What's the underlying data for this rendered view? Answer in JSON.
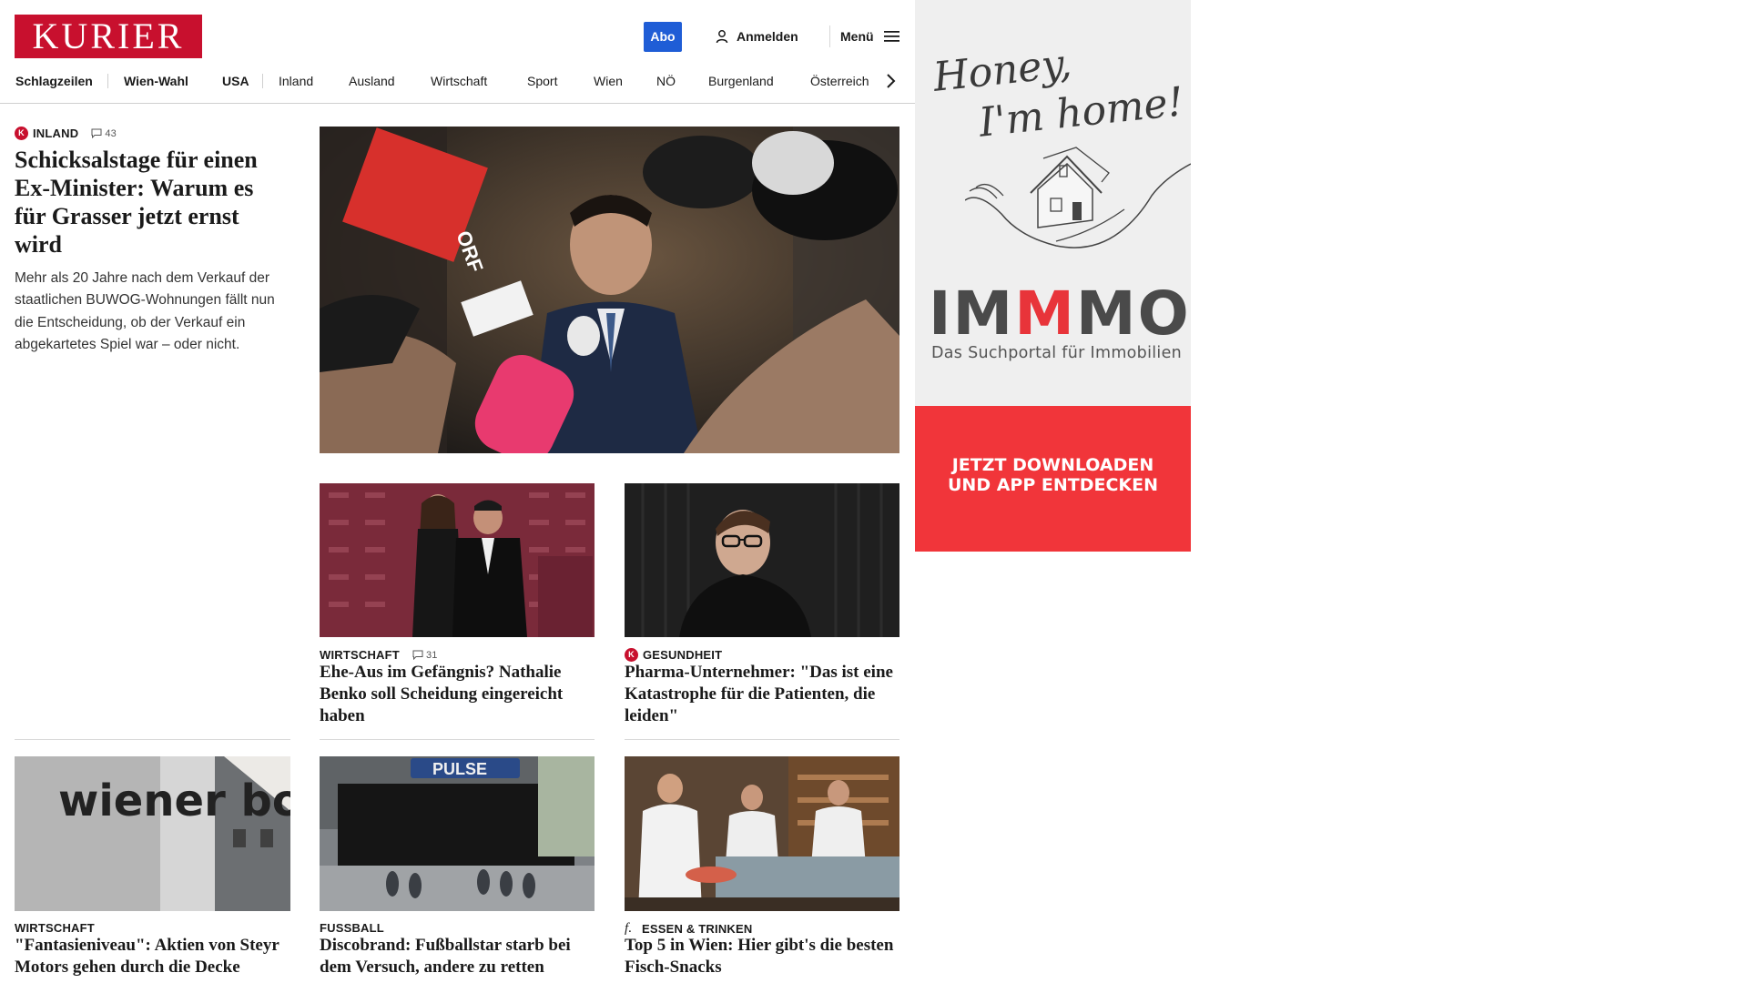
{
  "header": {
    "logo": "KURIER",
    "abo_label": "Abo",
    "login_label": "Anmelden",
    "menu_label": "Menü"
  },
  "nav": {
    "items": [
      "Schlagzeilen",
      "Wien-Wahl",
      "USA",
      "Inland",
      "Ausland",
      "Wirtschaft",
      "Sport",
      "Wien",
      "NÖ",
      "Burgenland",
      "Österreich"
    ]
  },
  "lead": {
    "category": "INLAND",
    "comments": "43",
    "headline": "Schicksalstage für einen Ex-Minister: Warum es für Grasser jetzt ernst wird",
    "teaser": "Mehr als 20 Jahre nach dem Verkauf der staatlichen BUWOG-Wohnungen fällt nun die Entscheidung, ob der Verkauf ein abgekartetes Spiel war – oder nicht."
  },
  "cards": [
    {
      "category": "WIRTSCHAFT",
      "comments": "31",
      "headline": "Ehe-Aus im Gefängnis? Nathalie Benko soll Scheidung eingereicht haben"
    },
    {
      "category": "GESUNDHEIT",
      "headline": "Pharma-Unternehmer: \"Das ist eine Katastrophe für die Patienten, die leiden\""
    },
    {
      "category": "WIRTSCHAFT",
      "headline": "\"Fantasieniveau\": Aktien von Steyr Motors gehen durch die Decke"
    },
    {
      "category": "FUSSBALL",
      "headline": "Discobrand: Fußballstar starb bei dem Versuch, andere zu retten"
    },
    {
      "category": "ESSEN & TRINKEN",
      "headline": "Top 5 in Wien: Hier gibt's die besten Fisch-Snacks"
    }
  ],
  "images": {
    "wiener_boerse_text": "wiener boerse",
    "pulse_sign": "PULSE",
    "orf_mic": "ORF"
  },
  "ad": {
    "tagline_1": "Honey,",
    "tagline_2": "I'm home!",
    "brand_1": "IM",
    "brand_red": "M",
    "brand_2": "MO",
    "subtitle": "Das Suchportal für Immobilien",
    "cta_1": "JETZT DOWNLOADEN",
    "cta_2": "UND APP ENTDECKEN"
  },
  "colors": {
    "brand_red": "#c8102e",
    "abo_blue": "#1f5dd6",
    "ad_red": "#f1353a"
  }
}
